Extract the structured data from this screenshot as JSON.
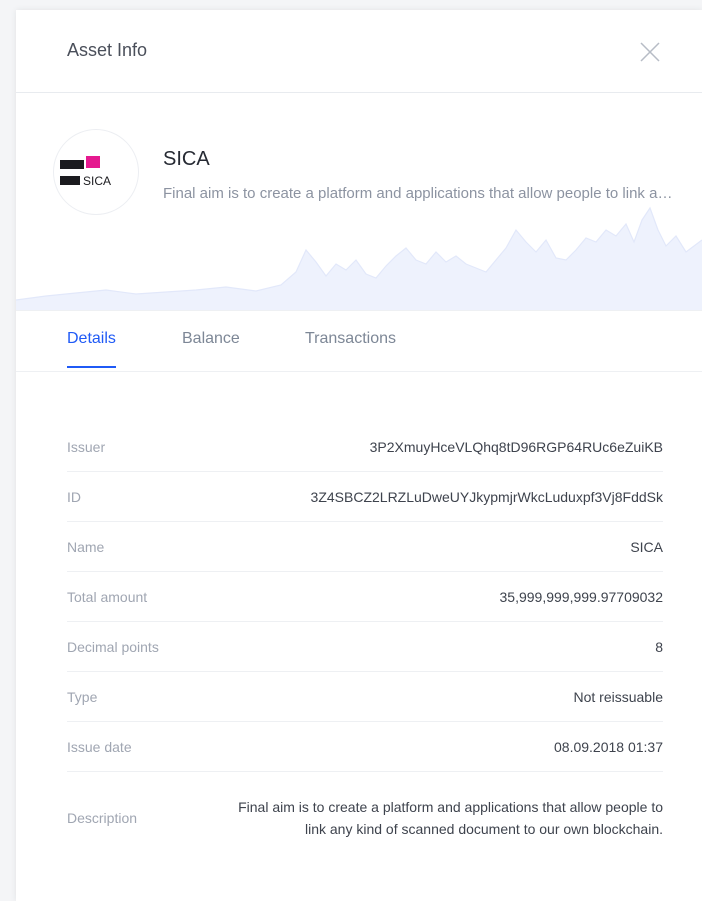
{
  "header": {
    "title": "Asset Info"
  },
  "asset": {
    "logo_text": "SICA",
    "name": "SICA",
    "description_preview": "Final aim is to create a platform and applications that allow people to link any kind of scanned document to our own blockchain."
  },
  "tabs": [
    {
      "label": "Details",
      "active": true
    },
    {
      "label": "Balance",
      "active": false
    },
    {
      "label": "Transactions",
      "active": false
    }
  ],
  "details": {
    "issuer": {
      "label": "Issuer",
      "value": "3P2XmuyHceVLQhq8tD96RGP64RUc6eZuiKB"
    },
    "id": {
      "label": "ID",
      "value": "3Z4SBCZ2LRZLuDweUYJkypmjrWkcLuduxpf3Vj8FddSk"
    },
    "name": {
      "label": "Name",
      "value": "SICA"
    },
    "total_amount": {
      "label": "Total amount",
      "value": "35,999,999,999.97709032"
    },
    "decimals": {
      "label": "Decimal points",
      "value": "8"
    },
    "type": {
      "label": "Type",
      "value": "Not reissuable"
    },
    "issue_date": {
      "label": "Issue date",
      "value": "08.09.2018 01:37"
    },
    "description": {
      "label": "Description",
      "value": "Final aim is to create a platform and applications that allow people to link any kind of scanned document to our own blockchain."
    }
  },
  "colors": {
    "accent": "#1f5af6",
    "logo_pink": "#e5198f",
    "logo_dark": "#1b1b1f"
  }
}
